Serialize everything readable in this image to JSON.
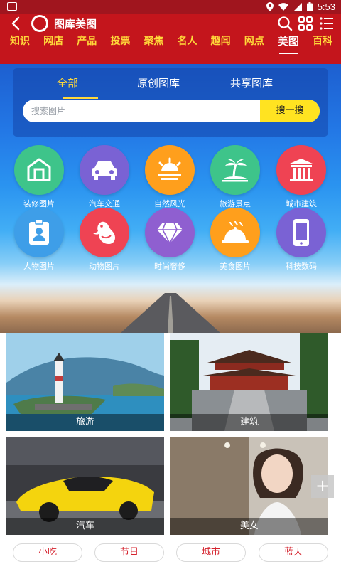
{
  "status_bar": {
    "time": "5:53"
  },
  "header": {
    "title": "图库美图",
    "tabs": [
      {
        "label": "知识",
        "active": false
      },
      {
        "label": "网店",
        "active": false
      },
      {
        "label": "产品",
        "active": false
      },
      {
        "label": "投票",
        "active": false
      },
      {
        "label": "聚焦",
        "active": false
      },
      {
        "label": "名人",
        "active": false
      },
      {
        "label": "趣闻",
        "active": false
      },
      {
        "label": "网点",
        "active": false
      },
      {
        "label": "美图",
        "active": true
      },
      {
        "label": "百科",
        "active": false
      }
    ]
  },
  "gallery_tabs": [
    {
      "label": "全部",
      "active": true
    },
    {
      "label": "原创图库",
      "active": false
    },
    {
      "label": "共享图库",
      "active": false
    }
  ],
  "search": {
    "placeholder": "搜索图片",
    "button_label": "搜一搜"
  },
  "categories": [
    {
      "label": "装修图片",
      "icon": "house-frame-icon",
      "color": "#3ec48a"
    },
    {
      "label": "汽车交通",
      "icon": "car-icon",
      "color": "#7a62d4"
    },
    {
      "label": "自然风光",
      "icon": "sunrise-icon",
      "color": "#ff9f1c"
    },
    {
      "label": "旅游景点",
      "icon": "palm-island-icon",
      "color": "#3ec48a"
    },
    {
      "label": "城市建筑",
      "icon": "building-icon",
      "color": "#ef4353"
    },
    {
      "label": "人物图片",
      "icon": "id-badge-icon",
      "color": "#3e9ee8"
    },
    {
      "label": "动物图片",
      "icon": "bird-icon",
      "color": "#ef4353"
    },
    {
      "label": "时尚奢侈",
      "icon": "diamond-icon",
      "color": "#8f5fd0"
    },
    {
      "label": "美食图片",
      "icon": "food-cloche-icon",
      "color": "#ff9f1c"
    },
    {
      "label": "科技数码",
      "icon": "smartphone-icon",
      "color": "#7a62d4"
    }
  ],
  "photos": [
    {
      "caption": "旅游"
    },
    {
      "caption": "建筑"
    },
    {
      "caption": "汽车"
    },
    {
      "caption": "美女"
    }
  ],
  "tags": [
    "小吃",
    "节日",
    "城市",
    "蓝天"
  ],
  "colors": {
    "header_red": "#c4151c",
    "tab_yellow": "#ffd83a",
    "search_button": "#ffe321",
    "tag_text": "#d5232e"
  }
}
